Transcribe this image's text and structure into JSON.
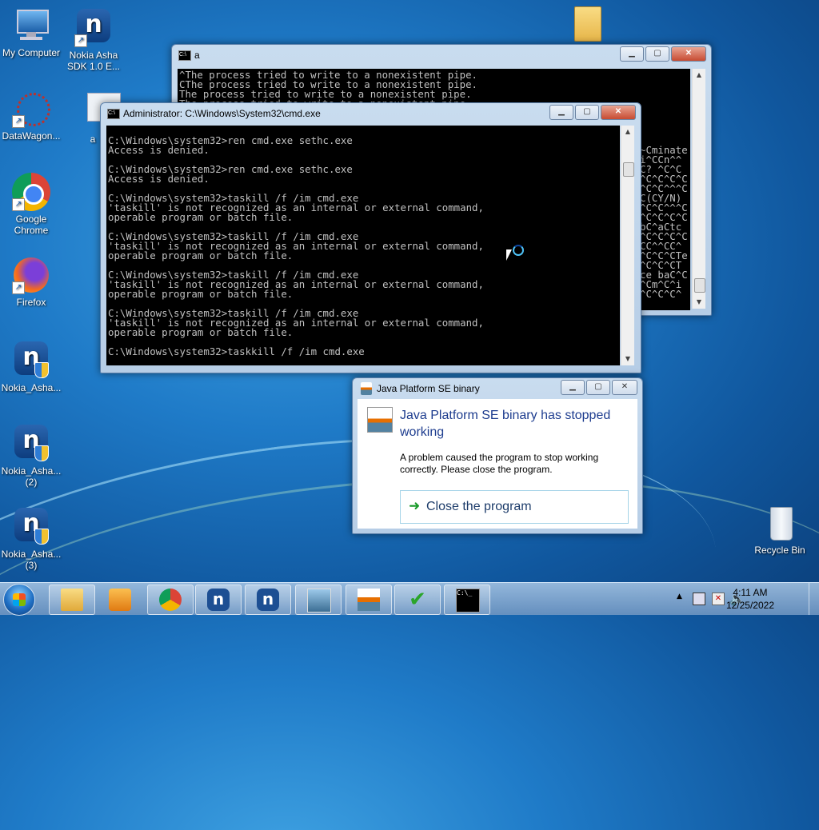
{
  "desktop": {
    "icons": [
      {
        "label": "My Computer"
      },
      {
        "label": "Nokia Asha SDK 1.0 E..."
      },
      {
        "label": "DataWagon..."
      },
      {
        "label": "a"
      },
      {
        "label": "Google Chrome"
      },
      {
        "label": "Firefox"
      },
      {
        "label": "Nokia_Asha..."
      },
      {
        "label": "Nokia_Asha... (2)"
      },
      {
        "label": "Nokia_Asha... (3)"
      },
      {
        "label": "Recycle Bin"
      }
    ]
  },
  "back_console": {
    "title": "a",
    "lines": [
      "^The process tried to write to a nonexistent pipe.",
      "CThe process tried to write to a nonexistent pipe.",
      "The process tried to write to a nonexistent pipe.",
      "The process tried to write to a nonexistent pipe."
    ],
    "right_edge_lines": [
      "~Cminate",
      "i^CCn^^",
      "C? ^C^C",
      "^C^C^C^C",
      "^C^C^^^C",
      "C(CY/N)",
      "^C^C^^^C",
      "^C^C^C^C",
      "bC^aCtc",
      "^C^C^C^C",
      "CC^^CC^",
      "^C^C^CTe",
      "^C^C^CT",
      "ce baC^C",
      "^Cm^C^i",
      "^C^C^C^"
    ]
  },
  "front_console": {
    "title": "Administrator: C:\\Windows\\System32\\cmd.exe",
    "lines": [
      "C:\\Windows\\system32>ren cmd.exe sethc.exe",
      "Access is denied.",
      "",
      "C:\\Windows\\system32>ren cmd.exe sethc.exe",
      "Access is denied.",
      "",
      "C:\\Windows\\system32>taskill /f /im cmd.exe",
      "'taskill' is not recognized as an internal or external command,",
      "operable program or batch file.",
      "",
      "C:\\Windows\\system32>taskill /f /im cmd.exe",
      "'taskill' is not recognized as an internal or external command,",
      "operable program or batch file.",
      "",
      "C:\\Windows\\system32>taskill /f /im cmd.exe",
      "'taskill' is not recognized as an internal or external command,",
      "operable program or batch file.",
      "",
      "C:\\Windows\\system32>taskill /f /im cmd.exe",
      "'taskill' is not recognized as an internal or external command,",
      "operable program or batch file.",
      "",
      "C:\\Windows\\system32>taskkill /f /im cmd.exe"
    ]
  },
  "dialog": {
    "title": "Java Platform SE binary",
    "heading": "Java Platform SE binary has stopped working",
    "message": "A problem caused the program to stop working correctly. Please close the program.",
    "close_label": "Close the program"
  },
  "taskbar": {
    "time": "4:11 AM",
    "date": "12/25/2022",
    "apps": [
      "explorer",
      "media-player",
      "chrome",
      "nokia-asha-1",
      "nokia-asha-2",
      "image-viewer",
      "java",
      "task-scheduler",
      "cmd"
    ]
  },
  "colors": {
    "console_bg": "#000000",
    "console_fg": "#c0c0c0",
    "dialog_heading": "#1e3d8f"
  }
}
